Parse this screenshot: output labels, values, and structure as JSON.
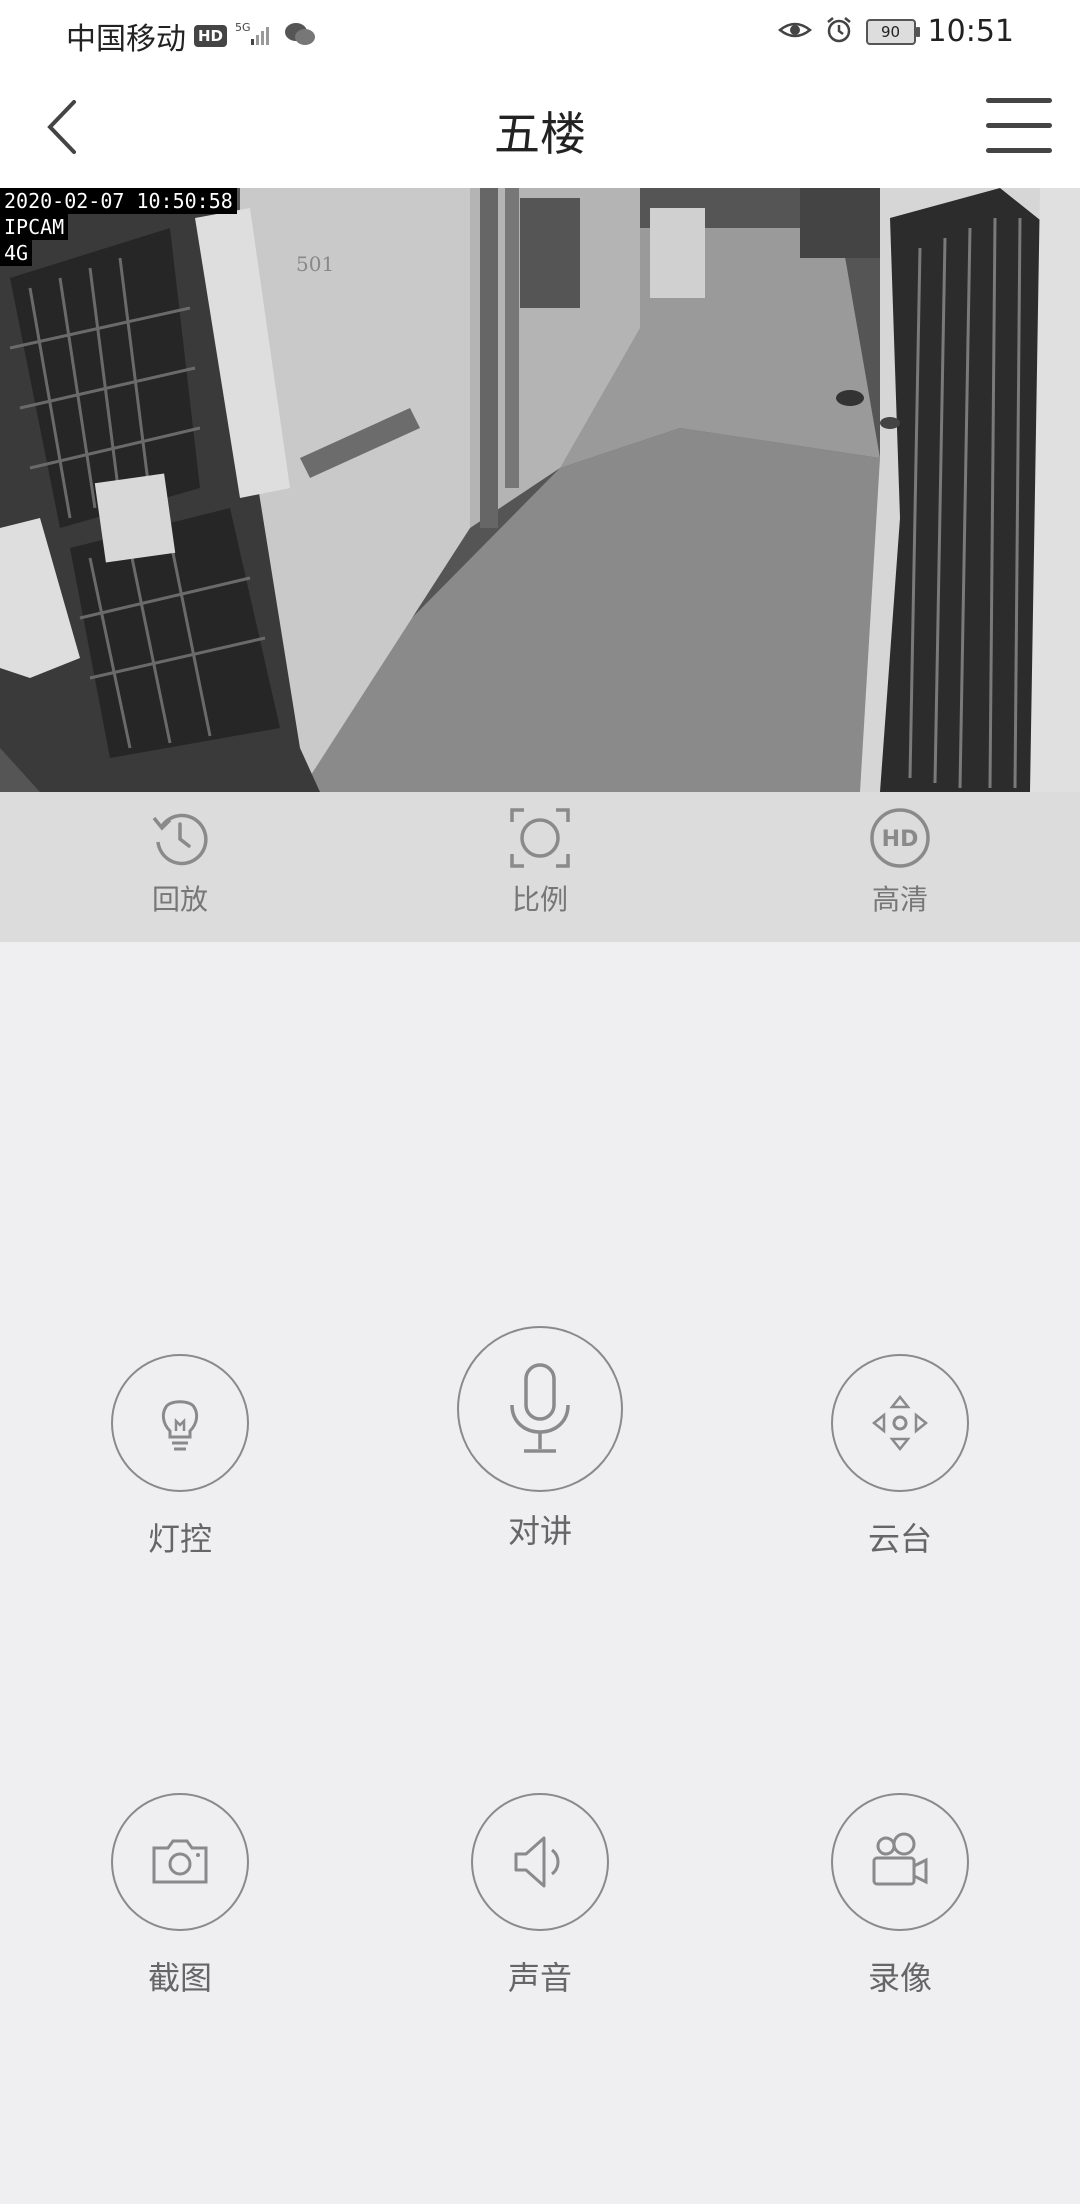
{
  "status_bar": {
    "carrier": "中国移动",
    "hd_badge": "HD",
    "network": "5G",
    "battery": "90",
    "time": "10:51"
  },
  "header": {
    "title": "五楼"
  },
  "video": {
    "timestamp": "2020-02-07 10:50:58",
    "camera_label": "IPCAM",
    "signal_label": "4G",
    "door_number": "501"
  },
  "controls": [
    {
      "label": "回放",
      "icon": "playback-history-icon"
    },
    {
      "label": "比例",
      "icon": "aspect-ratio-icon"
    },
    {
      "label": "高清",
      "icon": "hd-quality-icon"
    }
  ],
  "actions": [
    {
      "label": "灯控",
      "icon": "lightbulb-icon"
    },
    {
      "label": "对讲",
      "icon": "microphone-icon"
    },
    {
      "label": "云台",
      "icon": "ptz-direction-icon"
    },
    {
      "label": "截图",
      "icon": "camera-icon"
    },
    {
      "label": "声音",
      "icon": "speaker-icon"
    },
    {
      "label": "录像",
      "icon": "video-record-icon"
    }
  ],
  "colors": {
    "background": "#efeef1",
    "header": "#ffffff",
    "control_strip": "#dcdcdc",
    "icon_stroke": "#8a8a8a"
  }
}
